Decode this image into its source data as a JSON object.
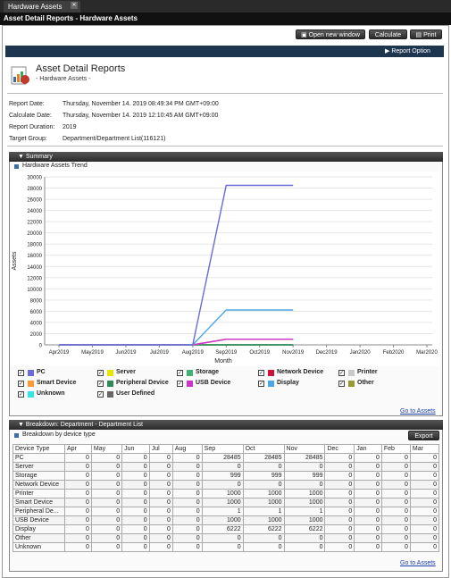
{
  "tab": {
    "title": "Hardware Assets"
  },
  "window": {
    "title": "Asset Detail Reports - Hardware Assets"
  },
  "toolbar": {
    "open_new_window": "Open new window",
    "calculate": "Calculate",
    "print": "Print"
  },
  "report_option": "Report Option",
  "header": {
    "title": "Asset Detail Reports",
    "subtitle": "- Hardware Assets -"
  },
  "info": [
    {
      "label": "Report Date:",
      "value": "Thursday, November 14. 2019 08:49:34 PM GMT+09:00"
    },
    {
      "label": "Calculate Date:",
      "value": "Thursday, November 14. 2019 12:10:45 AM GMT+09:00"
    },
    {
      "label": "Report Duration:",
      "value": "2019"
    },
    {
      "label": "Target Group:",
      "value": "Department/Department List(116121)"
    }
  ],
  "summary": {
    "header": "Summary",
    "chart_title": "Hardware Assets Trend",
    "go_to_assets": "Go to Assets"
  },
  "chart_data": {
    "type": "line",
    "title": "Hardware Assets Trend",
    "xlabel": "Month",
    "ylabel": "Assets",
    "ylim": [
      0,
      30000
    ],
    "yticks": [
      0,
      2000,
      4000,
      6000,
      8000,
      10000,
      12000,
      14000,
      16000,
      18000,
      20000,
      22000,
      24000,
      26000,
      28000,
      30000
    ],
    "categories": [
      "Apr2019",
      "May2019",
      "Jun2019",
      "Jul2019",
      "Aug2019",
      "Sep2019",
      "Oct2019",
      "Nov2019",
      "Dec2019",
      "Jan2020",
      "Feb2020",
      "Mar2020"
    ],
    "series": [
      {
        "name": "PC",
        "color": "#6a6ad8",
        "values": [
          0,
          0,
          0,
          0,
          0,
          28485,
          28485,
          28485
        ]
      },
      {
        "name": "Server",
        "color": "#e6e600",
        "values": [
          0,
          0,
          0,
          0,
          0,
          0,
          0,
          0
        ]
      },
      {
        "name": "Storage",
        "color": "#3cb371",
        "values": [
          0,
          0,
          0,
          0,
          0,
          999,
          999,
          999
        ]
      },
      {
        "name": "Network Device",
        "color": "#d0103a",
        "values": [
          0,
          0,
          0,
          0,
          0,
          0,
          0,
          0
        ]
      },
      {
        "name": "Printer",
        "color": "#c8c8c8",
        "values": [
          0,
          0,
          0,
          0,
          0,
          1000,
          1000,
          1000
        ]
      },
      {
        "name": "Smart Device",
        "color": "#ff9933",
        "values": [
          0,
          0,
          0,
          0,
          0,
          1000,
          1000,
          1000
        ]
      },
      {
        "name": "Peripheral Device",
        "color": "#2e8b57",
        "values": [
          0,
          0,
          0,
          0,
          0,
          1,
          1,
          1
        ]
      },
      {
        "name": "USB Device",
        "color": "#cc33cc",
        "values": [
          0,
          0,
          0,
          0,
          0,
          1000,
          1000,
          1000
        ]
      },
      {
        "name": "Display",
        "color": "#4da6e6",
        "values": [
          0,
          0,
          0,
          0,
          0,
          6222,
          6222,
          6222
        ]
      },
      {
        "name": "Other",
        "color": "#999933",
        "values": [
          0,
          0,
          0,
          0,
          0,
          0,
          0,
          0
        ]
      },
      {
        "name": "Unknown",
        "color": "#33e6e6",
        "values": [
          0,
          0,
          0,
          0,
          0,
          0,
          0,
          0
        ]
      },
      {
        "name": "User Defined",
        "color": "#666666",
        "values": []
      }
    ],
    "grid": true,
    "legend": "bottom"
  },
  "breakdown": {
    "header": "Breakdown: Department - Department List",
    "subtitle": "Breakdown by device type",
    "export": "Export",
    "go_to_assets": "Go to Assets",
    "columns": [
      "Device Type",
      "Apr",
      "May",
      "Jun",
      "Jul",
      "Aug",
      "Sep",
      "Oct",
      "Nov",
      "Dec",
      "Jan",
      "Feb",
      "Mar"
    ],
    "rows": [
      [
        "PC",
        "0",
        "0",
        "0",
        "0",
        "0",
        "28485",
        "28485",
        "28485",
        "0",
        "0",
        "0",
        "0"
      ],
      [
        "Server",
        "0",
        "0",
        "0",
        "0",
        "0",
        "0",
        "0",
        "0",
        "0",
        "0",
        "0",
        "0"
      ],
      [
        "Storage",
        "0",
        "0",
        "0",
        "0",
        "0",
        "999",
        "999",
        "999",
        "0",
        "0",
        "0",
        "0"
      ],
      [
        "Network Device",
        "0",
        "0",
        "0",
        "0",
        "0",
        "0",
        "0",
        "0",
        "0",
        "0",
        "0",
        "0"
      ],
      [
        "Printer",
        "0",
        "0",
        "0",
        "0",
        "0",
        "1000",
        "1000",
        "1000",
        "0",
        "0",
        "0",
        "0"
      ],
      [
        "Smart Device",
        "0",
        "0",
        "0",
        "0",
        "0",
        "1000",
        "1000",
        "1000",
        "0",
        "0",
        "0",
        "0"
      ],
      [
        "Peripheral De...",
        "0",
        "0",
        "0",
        "0",
        "0",
        "1",
        "1",
        "1",
        "0",
        "0",
        "0",
        "0"
      ],
      [
        "USB Device",
        "0",
        "0",
        "0",
        "0",
        "0",
        "1000",
        "1000",
        "1000",
        "0",
        "0",
        "0",
        "0"
      ],
      [
        "Display",
        "0",
        "0",
        "0",
        "0",
        "0",
        "6222",
        "6222",
        "6222",
        "0",
        "0",
        "0",
        "0"
      ],
      [
        "Other",
        "0",
        "0",
        "0",
        "0",
        "0",
        "0",
        "0",
        "0",
        "0",
        "0",
        "0",
        "0"
      ],
      [
        "Unknown",
        "0",
        "0",
        "0",
        "0",
        "0",
        "0",
        "0",
        "0",
        "0",
        "0",
        "0",
        "0"
      ]
    ]
  }
}
